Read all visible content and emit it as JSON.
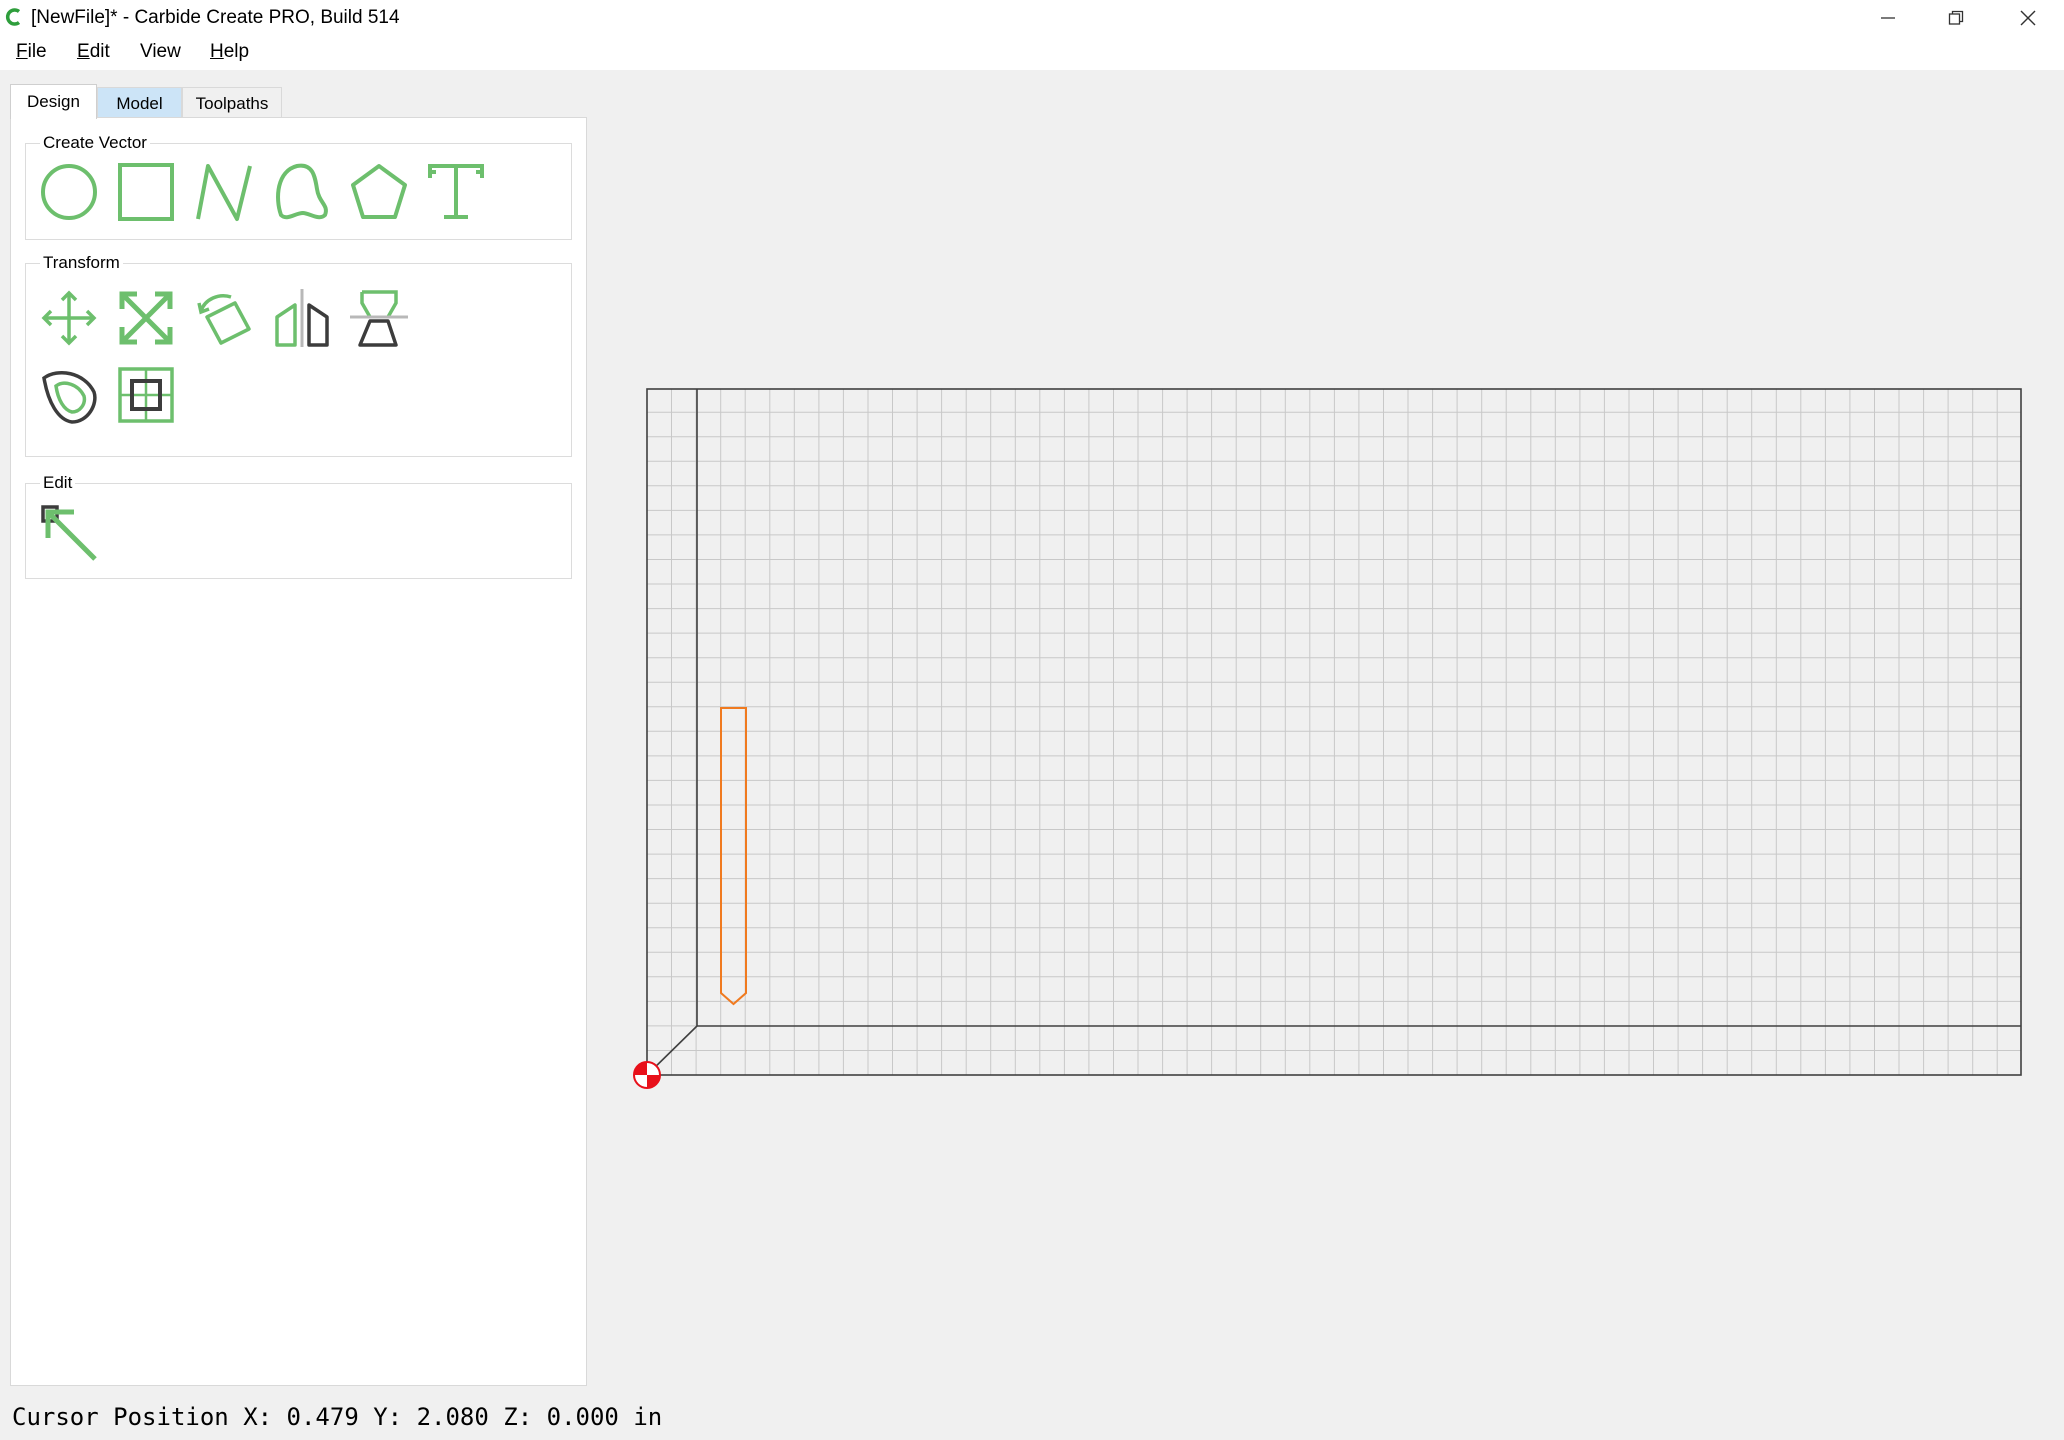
{
  "window": {
    "title": "[NewFile]* - Carbide Create PRO, Build 514",
    "logo_icon": "carbide-create-logo",
    "controls": [
      "minimize-icon",
      "restore-icon",
      "close-icon"
    ]
  },
  "menu": {
    "items": [
      {
        "mnemonic": "F",
        "rest": "ile"
      },
      {
        "mnemonic": "E",
        "rest": "dit"
      },
      {
        "mnemonic": "",
        "rest": "View"
      },
      {
        "mnemonic": "H",
        "rest": "elp"
      }
    ]
  },
  "tabs": [
    {
      "label": "Design",
      "active": true
    },
    {
      "label": "Model",
      "active": false
    },
    {
      "label": "Toolpaths",
      "active": false
    }
  ],
  "groups": {
    "create_vector": {
      "title": "Create Vector",
      "tools": [
        "circle-tool-icon",
        "rectangle-tool-icon",
        "polyline-tool-icon",
        "curve-tool-icon",
        "polygon-tool-icon",
        "text-tool-icon"
      ]
    },
    "transform": {
      "title": "Transform",
      "tools": [
        "move-icon",
        "scale-icon",
        "rotate-icon",
        "mirror-icon",
        "align-icon",
        "offset-icon",
        "node-edit-icon"
      ]
    },
    "edit": {
      "title": "Edit",
      "tools": [
        "select-icon"
      ]
    }
  },
  "colors": {
    "tool_green": "#6dbf6d",
    "tool_dark": "#3c3c3c",
    "vector_orange": "#f07a1f",
    "origin_red": "#e8101a",
    "grid_line": "#c8c8c8",
    "selected_tab": "#cce4f7"
  },
  "status": {
    "text": "Cursor Position X: 0.479 Y: 2.080 Z: 0.000 in"
  }
}
